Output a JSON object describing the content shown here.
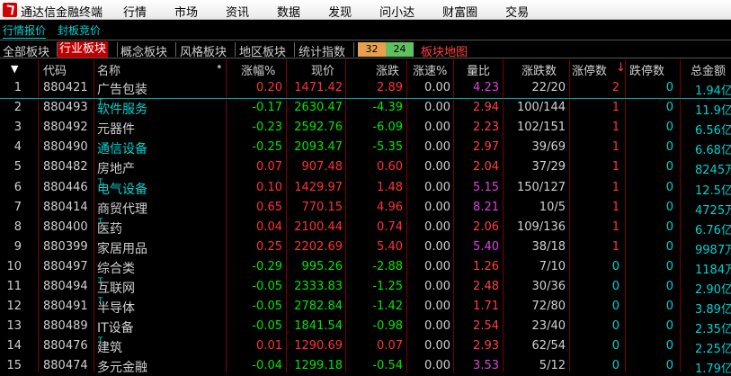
{
  "app": {
    "title": "通达信金融终端",
    "menu": [
      "行情",
      "市场",
      "资讯",
      "数据",
      "发现",
      "问小达",
      "财富圈",
      "交易"
    ]
  },
  "subtoolbar": {
    "quotes": "行情报价",
    "limitup": "封板竞价"
  },
  "tabs": {
    "items": [
      "全部板块",
      "行业板块",
      "概念板块",
      "风格板块",
      "地区板块",
      "统计指数"
    ],
    "active_index": 1,
    "up_count": "32",
    "down_count": "24",
    "map": "板块地图"
  },
  "table": {
    "headers": {
      "sort_icon": "▼",
      "code": "代码",
      "name": "名称",
      "dot": "•",
      "pct": "涨幅%",
      "price": "现价",
      "chg": "涨跌",
      "speed": "涨速%",
      "vol_ratio": "量比",
      "updown": "涨跌数",
      "limit_up": "涨停数",
      "sort_arrow": "↓",
      "limit_down": "跌停数",
      "amount": "总金额"
    },
    "rows": [
      {
        "idx": "1",
        "code": "880421",
        "name": "广告包装",
        "sup": "",
        "name_color": "#d0d0d0",
        "pct": "0.20",
        "price": "1471.42",
        "chg": "2.89",
        "speed": "0.00",
        "vr": "4.23",
        "vr_color": "#e040e0",
        "ud": "22/20",
        "lu": "2",
        "ld": "0",
        "amt": "1.94亿",
        "dir": "up"
      },
      {
        "idx": "2",
        "code": "880493",
        "name": "软件服务",
        "sup": "T",
        "name_color": "#00d2d2",
        "pct": "-0.17",
        "price": "2630.47",
        "chg": "-4.39",
        "speed": "0.00",
        "vr": "2.94",
        "vr_color": "#ff4040",
        "ud": "100/144",
        "lu": "1",
        "ld": "0",
        "amt": "11.9亿",
        "dir": "down"
      },
      {
        "idx": "3",
        "code": "880492",
        "name": "元器件",
        "sup": "",
        "name_color": "#d0d0d0",
        "pct": "-0.23",
        "price": "2592.76",
        "chg": "-6.09",
        "speed": "0.00",
        "vr": "2.23",
        "vr_color": "#ff4040",
        "ud": "102/151",
        "lu": "1",
        "ld": "0",
        "amt": "6.56亿",
        "dir": "down"
      },
      {
        "idx": "4",
        "code": "880490",
        "name": "通信设备",
        "sup": "",
        "name_color": "#00d2d2",
        "pct": "-0.25",
        "price": "2093.47",
        "chg": "-5.35",
        "speed": "0.00",
        "vr": "2.97",
        "vr_color": "#ff4040",
        "ud": "39/69",
        "lu": "1",
        "ld": "0",
        "amt": "6.68亿",
        "dir": "down"
      },
      {
        "idx": "5",
        "code": "880482",
        "name": "房地产",
        "sup": "",
        "name_color": "#d0d0d0",
        "pct": "0.07",
        "price": "907.48",
        "chg": "0.60",
        "speed": "0.00",
        "vr": "2.04",
        "vr_color": "#ff4040",
        "ud": "37/29",
        "lu": "1",
        "ld": "0",
        "amt": "8245万",
        "dir": "up"
      },
      {
        "idx": "6",
        "code": "880446",
        "name": "电气设备",
        "sup": "T",
        "name_color": "#00d2d2",
        "pct": "0.10",
        "price": "1429.97",
        "chg": "1.48",
        "speed": "0.00",
        "vr": "5.15",
        "vr_color": "#e040e0",
        "ud": "150/127",
        "lu": "1",
        "ld": "0",
        "amt": "12.5亿",
        "dir": "up"
      },
      {
        "idx": "7",
        "code": "880414",
        "name": "商贸代理",
        "sup": "",
        "name_color": "#d0d0d0",
        "pct": "0.65",
        "price": "770.15",
        "chg": "4.96",
        "speed": "0.00",
        "vr": "8.21",
        "vr_color": "#e040e0",
        "ud": "10/5",
        "lu": "1",
        "ld": "0",
        "amt": "4725万",
        "dir": "up"
      },
      {
        "idx": "8",
        "code": "880400",
        "name": "医药",
        "sup": "T",
        "name_color": "#d0d0d0",
        "pct": "0.04",
        "price": "2100.44",
        "chg": "0.74",
        "speed": "0.00",
        "vr": "2.06",
        "vr_color": "#ff4040",
        "ud": "109/136",
        "lu": "1",
        "ld": "0",
        "amt": "6.76亿",
        "dir": "up"
      },
      {
        "idx": "9",
        "code": "880399",
        "name": "家居用品",
        "sup": "",
        "name_color": "#d0d0d0",
        "pct": "0.25",
        "price": "2202.69",
        "chg": "5.40",
        "speed": "0.00",
        "vr": "5.40",
        "vr_color": "#e040e0",
        "ud": "38/18",
        "lu": "1",
        "ld": "0",
        "amt": "9987万",
        "dir": "up"
      },
      {
        "idx": "10",
        "code": "880497",
        "name": "综合类",
        "sup": "",
        "name_color": "#d0d0d0",
        "pct": "-0.29",
        "price": "995.26",
        "chg": "-2.88",
        "speed": "0.00",
        "vr": "1.26",
        "vr_color": "#ff4040",
        "ud": "7/10",
        "lu": "0",
        "ld": "0",
        "amt": "1184万",
        "dir": "down"
      },
      {
        "idx": "11",
        "code": "880494",
        "name": "互联网",
        "sup": "T",
        "name_color": "#d0d0d0",
        "pct": "-0.05",
        "price": "2333.83",
        "chg": "-1.25",
        "speed": "0.00",
        "vr": "2.48",
        "vr_color": "#ff4040",
        "ud": "30/36",
        "lu": "0",
        "ld": "0",
        "amt": "2.90亿",
        "dir": "down"
      },
      {
        "idx": "12",
        "code": "880491",
        "name": "半导体",
        "sup": "T",
        "name_color": "#d0d0d0",
        "pct": "-0.05",
        "price": "2782.84",
        "chg": "-1.42",
        "speed": "0.00",
        "vr": "1.71",
        "vr_color": "#ff4040",
        "ud": "72/80",
        "lu": "0",
        "ld": "0",
        "amt": "3.89亿",
        "dir": "down"
      },
      {
        "idx": "13",
        "code": "880489",
        "name": "IT设备",
        "sup": "",
        "name_color": "#d0d0d0",
        "pct": "-0.05",
        "price": "1841.54",
        "chg": "-0.98",
        "speed": "0.00",
        "vr": "2.54",
        "vr_color": "#ff4040",
        "ud": "23/40",
        "lu": "0",
        "ld": "0",
        "amt": "2.35亿",
        "dir": "down"
      },
      {
        "idx": "14",
        "code": "880476",
        "name": "建筑",
        "sup": "T",
        "name_color": "#d0d0d0",
        "pct": "0.01",
        "price": "1290.69",
        "chg": "0.07",
        "speed": "0.00",
        "vr": "2.93",
        "vr_color": "#ff4040",
        "ud": "62/54",
        "lu": "0",
        "ld": "0",
        "amt": "2.25亿",
        "dir": "up"
      },
      {
        "idx": "15",
        "code": "880474",
        "name": "多元金融",
        "sup": "",
        "name_color": "#d0d0d0",
        "pct": "-0.04",
        "price": "1299.18",
        "chg": "-0.54",
        "speed": "0.00",
        "vr": "3.53",
        "vr_color": "#e040e0",
        "ud": "5/12",
        "lu": "0",
        "ld": "0",
        "amt": "1.79亿",
        "dir": "down"
      }
    ]
  },
  "colors": {
    "up": "#ff3232",
    "down": "#00e600",
    "neutral": "#d0d0d0",
    "cyan": "#00d2d2",
    "limit_up_nonzero": "#ff3232",
    "zero_value": "#00d2d2"
  }
}
